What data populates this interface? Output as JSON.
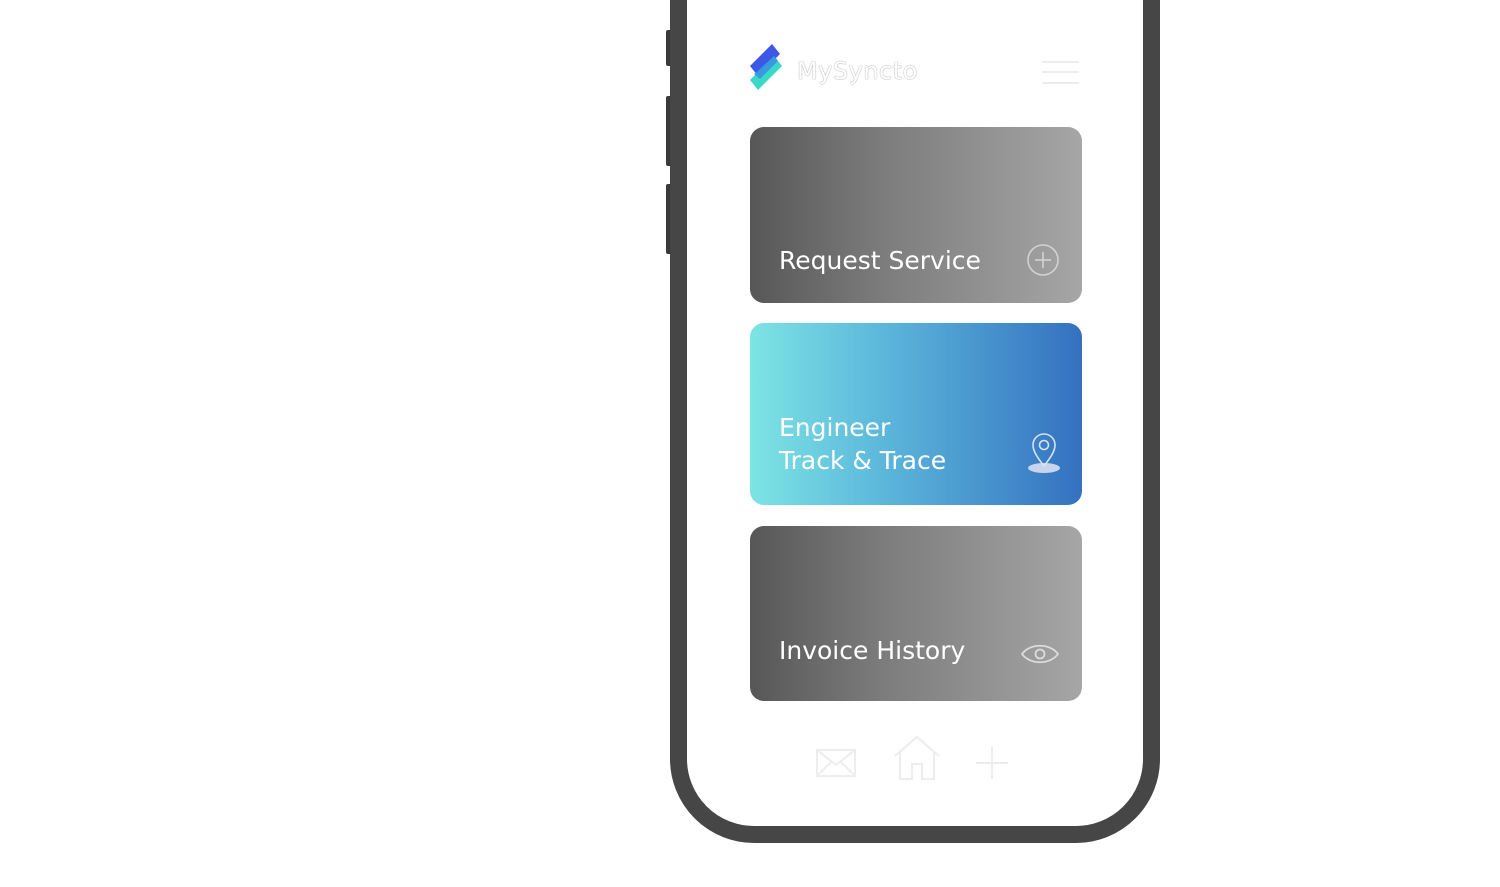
{
  "app": {
    "brand": "MySyncto"
  },
  "colors": {
    "frame": "#464646",
    "gray_card_start": "#575757",
    "gray_card_end": "#a6a6a6",
    "blue_card_start": "#7de4e4",
    "blue_card_end": "#3471c0",
    "logo_blue": "#3d57e6",
    "logo_teal": "#2fd6c4"
  },
  "header": {
    "logo_icon": "stacked-parallelogram-logo",
    "menu_icon": "hamburger-menu-icon"
  },
  "cards": [
    {
      "label_lines": [
        "Request Service"
      ],
      "icon": "plus-circle-icon"
    },
    {
      "label_lines": [
        "Engineer",
        "Track & Trace"
      ],
      "icon": "location-pin-icon"
    },
    {
      "label_lines": [
        "Invoice History"
      ],
      "icon": "eye-icon"
    }
  ],
  "bottom_nav": [
    {
      "icon": "mail-icon"
    },
    {
      "icon": "home-icon"
    },
    {
      "icon": "plus-icon"
    }
  ]
}
